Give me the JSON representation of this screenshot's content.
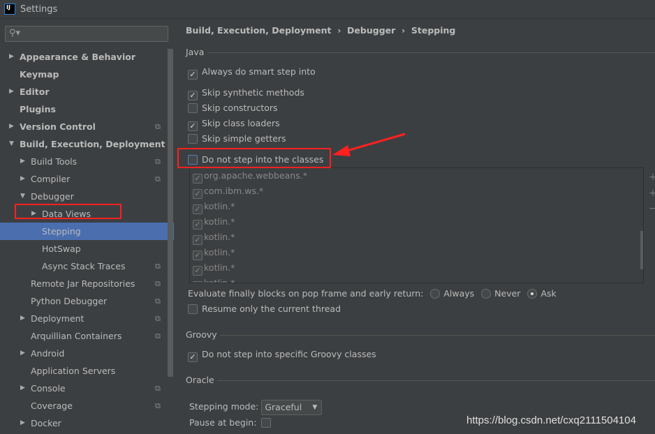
{
  "window": {
    "title": "Settings",
    "logo": "IJ"
  },
  "search": {
    "placeholder": "",
    "icon": "search-icon"
  },
  "tree": [
    {
      "label": "Appearance & Behavior",
      "level": 0,
      "bold": true,
      "arrow": "right",
      "copy": false
    },
    {
      "label": "Keymap",
      "level": 0,
      "bold": true,
      "arrow": "",
      "copy": false
    },
    {
      "label": "Editor",
      "level": 0,
      "bold": true,
      "arrow": "right",
      "copy": false
    },
    {
      "label": "Plugins",
      "level": 0,
      "bold": true,
      "arrow": "",
      "copy": false
    },
    {
      "label": "Version Control",
      "level": 0,
      "bold": true,
      "arrow": "right",
      "copy": true
    },
    {
      "label": "Build, Execution, Deployment",
      "level": 0,
      "bold": true,
      "arrow": "down",
      "copy": false
    },
    {
      "label": "Build Tools",
      "level": 1,
      "arrow": "right",
      "copy": true
    },
    {
      "label": "Compiler",
      "level": 1,
      "arrow": "right",
      "copy": true
    },
    {
      "label": "Debugger",
      "level": 1,
      "arrow": "down",
      "copy": false
    },
    {
      "label": "Data Views",
      "level": 2,
      "arrow": "right",
      "copy": false
    },
    {
      "label": "Stepping",
      "level": 2,
      "arrow": "",
      "copy": false,
      "selected": true
    },
    {
      "label": "HotSwap",
      "level": 2,
      "arrow": "",
      "copy": false
    },
    {
      "label": "Async Stack Traces",
      "level": 2,
      "arrow": "",
      "copy": true
    },
    {
      "label": "Remote Jar Repositories",
      "level": 1,
      "arrow": "",
      "copy": true
    },
    {
      "label": "Python Debugger",
      "level": 1,
      "arrow": "",
      "copy": true
    },
    {
      "label": "Deployment",
      "level": 1,
      "arrow": "right",
      "copy": true
    },
    {
      "label": "Arquillian Containers",
      "level": 1,
      "arrow": "",
      "copy": true
    },
    {
      "label": "Android",
      "level": 1,
      "arrow": "right",
      "copy": false
    },
    {
      "label": "Application Servers",
      "level": 1,
      "arrow": "",
      "copy": false
    },
    {
      "label": "Console",
      "level": 1,
      "arrow": "right",
      "copy": true
    },
    {
      "label": "Coverage",
      "level": 1,
      "arrow": "",
      "copy": true
    },
    {
      "label": "Docker",
      "level": 1,
      "arrow": "right",
      "copy": false
    }
  ],
  "breadcrumb": [
    "Build, Execution, Deployment",
    "Debugger",
    "Stepping"
  ],
  "java": {
    "title": "Java",
    "options": [
      {
        "label": "Always do smart step into",
        "checked": true
      },
      {
        "label": "Skip synthetic methods",
        "checked": true
      },
      {
        "label": "Skip constructors",
        "checked": false
      },
      {
        "label": "Skip class loaders",
        "checked": true
      },
      {
        "label": "Skip simple getters",
        "checked": false
      },
      {
        "label": "Do not step into the classes",
        "checked": false
      }
    ],
    "classes": [
      "org.apache.webbeans.*",
      "com.ibm.ws.*",
      "kotlin.*",
      "kotlin.*",
      "kotlin.*",
      "kotlin.*",
      "kotlin.*",
      "kotlin.*"
    ],
    "evaluate_label": "Evaluate finally blocks on pop frame and early return:",
    "evaluate_options": [
      "Always",
      "Never",
      "Ask"
    ],
    "evaluate_selected": "Ask",
    "resume_label": "Resume only the current thread",
    "resume_checked": false
  },
  "groovy": {
    "title": "Groovy",
    "option": "Do not step into specific Groovy classes",
    "checked": true
  },
  "oracle": {
    "title": "Oracle",
    "stepping_mode_label": "Stepping mode:",
    "stepping_mode": "Graceful",
    "pause_label": "Pause at begin:",
    "pause_checked": false
  },
  "watermark": "https://blog.csdn.net/cxq2111504104",
  "colors": {
    "selection": "#4b6eaf",
    "annotation": "#ff2020",
    "background": "#3c3f41"
  }
}
